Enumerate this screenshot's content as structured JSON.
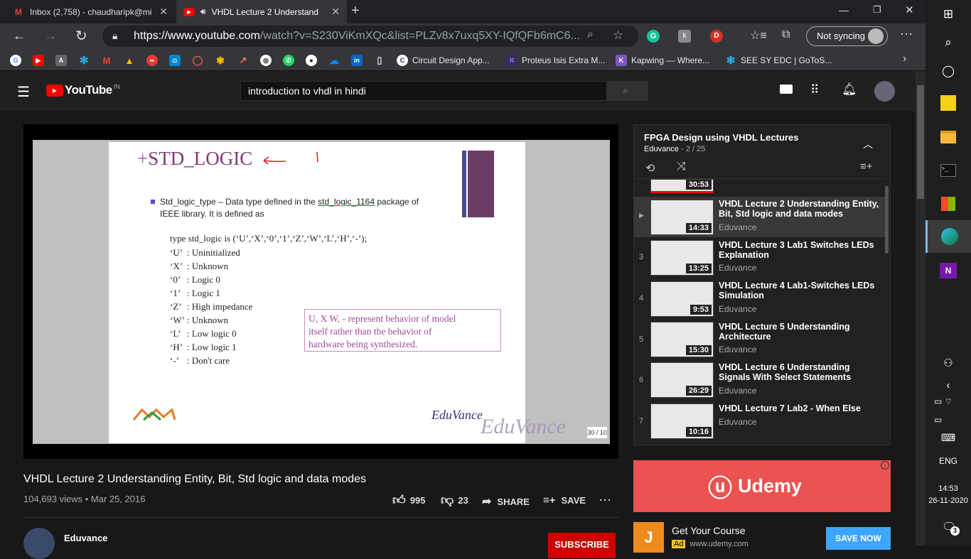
{
  "tabs": [
    {
      "title": "Inbox (2,758) - chaudharipk@mi",
      "icon": "gmail-icon"
    },
    {
      "title": "VHDL Lecture 2 Understand",
      "icon": "youtube-icon"
    }
  ],
  "address": {
    "url_main": "https://www.youtube.com",
    "url_rest": "/watch?v=S230ViKmXQc&list=PLZv8x7uxq5XY-IQfQFb6mC6...",
    "profile_label": "Not syncing"
  },
  "bookmarks": [
    "Circuit Design App...",
    "Proteus Isis Extra M...",
    "Kapwing — Where...",
    "SEE SY EDC | GoToS..."
  ],
  "youtube": {
    "logo": "YouTube",
    "region": "IN",
    "search_value": "introduction to vhdl in hindi"
  },
  "slide": {
    "title": "STD_LOGIC",
    "bullet_label": "Std_logic_type",
    "bullet_text1": " – Data type defined in the ",
    "bullet_pkg": "std_logic_1164",
    "bullet_text2": " package of",
    "bullet_line2": "IEEE library. It is defined as",
    "type_decl": "type std_logic is (‘U’,‘X’,‘0’,‘1’,‘Z’,‘W’,‘L’,‘H’,‘-’);",
    "values": [
      {
        "k": "‘U’",
        "v": ": Uninitialized"
      },
      {
        "k": "‘X’",
        "v": ": Unknown"
      },
      {
        "k": "‘0’",
        "v": ": Logic 0"
      },
      {
        "k": "‘1’",
        "v": ": Logic 1"
      },
      {
        "k": "‘Z’",
        "v": ": High impedance"
      },
      {
        "k": "‘W’",
        "v": ": Unknown"
      },
      {
        "k": "‘L’",
        "v": ": Low logic 0"
      },
      {
        "k": "‘H’",
        "v": ": Low logic 1"
      },
      {
        "k": "‘-’",
        "v": ": Don't care"
      }
    ],
    "note_line1": "U, X W, - represent behavior of model",
    "note_line2": "itself rather than the behavior of",
    "note_line3": "hardware being synthesized.",
    "brand": "EduVance",
    "brand_big": "EduVance",
    "page": "30 / 10"
  },
  "video": {
    "title": "VHDL Lecture 2 Understanding Entity, Bit, Std logic and data modes",
    "meta": "104,693 views • Mar 25, 2016",
    "likes": "995",
    "dislikes": "23",
    "share": "SHARE",
    "save": "SAVE",
    "channel": "Eduvance",
    "subscribe": "SUBSCRIBE"
  },
  "playlist": {
    "title": "FPGA Design using VHDL Lectures",
    "subtitle_channel": "Eduvance",
    "subtitle_pos": " - 2 / 25",
    "prev_duration": "30:53",
    "items": [
      {
        "num": "▶",
        "title": "VHDL Lecture 2 Understanding Entity, Bit, Std logic and data modes",
        "channel": "Eduvance",
        "duration": "14:33"
      },
      {
        "num": "3",
        "title": "VHDL Lecture 3 Lab1 Switches LEDs Explanation",
        "channel": "Eduvance",
        "duration": "13:25"
      },
      {
        "num": "4",
        "title": "VHDL Lecture 4 Lab1-Switches LEDs Simulation",
        "channel": "Eduvance",
        "duration": "9:53"
      },
      {
        "num": "5",
        "title": "VHDL Lecture 5 Understanding Architecture",
        "channel": "Eduvance",
        "duration": "15:30"
      },
      {
        "num": "6",
        "title": "VHDL Lecture 6 Understanding Signals With Select Statements",
        "channel": "Eduvance",
        "duration": "26:29"
      },
      {
        "num": "7",
        "title": "VHDL Lecture 7 Lab2 - When Else",
        "channel": "Eduvance",
        "duration": "10:16"
      }
    ]
  },
  "ad": {
    "brand": "Udemy",
    "title": "Get Your Course",
    "badge": "Ad",
    "url": "www.udemy.com",
    "cta": "SAVE NOW"
  },
  "taskbar": {
    "lang": "ENG",
    "time": "14:53",
    "date": "26-11-2020",
    "notif_count": "3"
  },
  "colors": {
    "yt_red": "#ff0000",
    "udemy": "#ec5252",
    "link_blue": "#3ea6ff"
  }
}
